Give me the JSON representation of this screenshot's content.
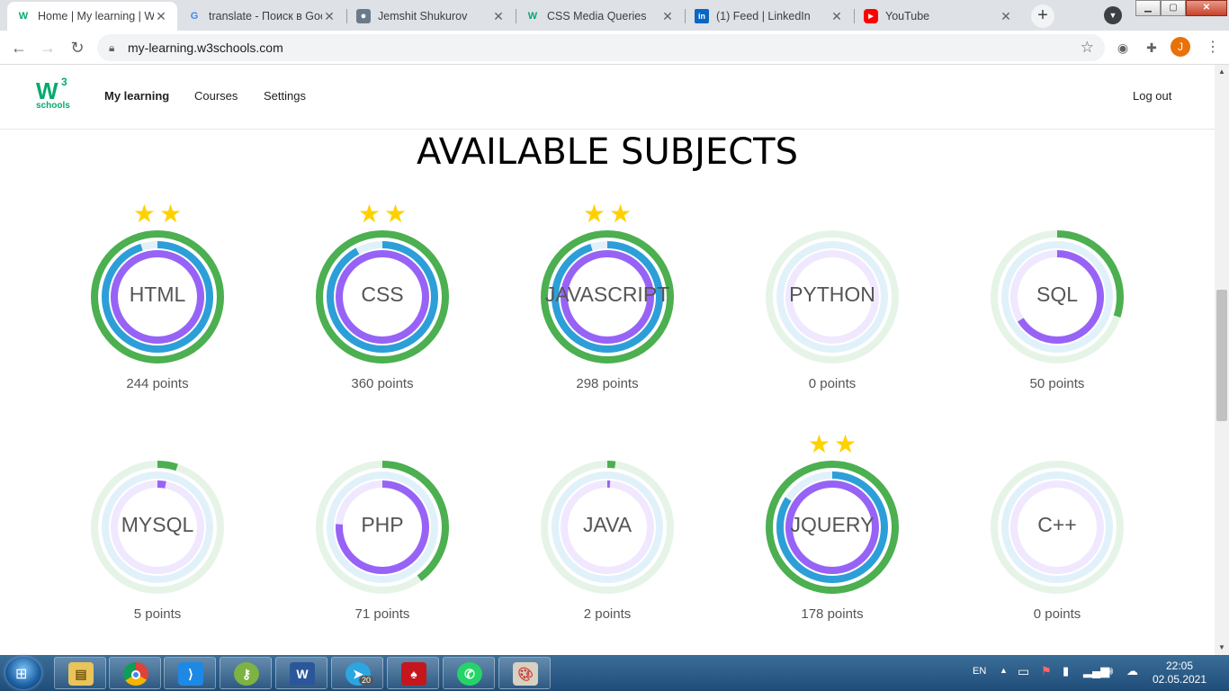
{
  "browser": {
    "tabs": [
      {
        "title": "Home | My learning | W",
        "favicon": "w3schools-icon",
        "active": true
      },
      {
        "title": "translate - Поиск в Goo",
        "favicon": "google-icon",
        "active": false
      },
      {
        "title": "Jemshit Shukurov",
        "favicon": "profile-photo-icon",
        "active": false
      },
      {
        "title": "CSS Media Queries",
        "favicon": "w3schools-icon",
        "active": false
      },
      {
        "title": "(1) Feed | LinkedIn",
        "favicon": "linkedin-icon",
        "active": false
      },
      {
        "title": "YouTube",
        "favicon": "youtube-icon",
        "active": false
      }
    ],
    "url": "my-learning.w3schools.com",
    "profile_initial": "J"
  },
  "site": {
    "logo_text": "W",
    "logo_super": "3",
    "logo_sub": "schools",
    "nav": [
      "My learning",
      "Courses",
      "Settings"
    ],
    "logout": "Log out",
    "heading": "AVAILABLE SUBJECTS"
  },
  "colors": {
    "outer_ring": "#4caf50",
    "middle_ring": "#2d9fd8",
    "inner_ring": "#9763f6",
    "outer_track": "#e6f4e7",
    "middle_track": "#e1f1fa",
    "inner_track": "#f0e8fe",
    "star": "#ffd100",
    "brand": "#04aa6d"
  },
  "subjects": [
    {
      "name": "HTML",
      "points": "244 points",
      "stars": 2,
      "progress": [
        1.0,
        0.95,
        1.0
      ]
    },
    {
      "name": "CSS",
      "points": "360 points",
      "stars": 2,
      "progress": [
        1.0,
        0.92,
        1.0
      ]
    },
    {
      "name": "JAVASCRIPT",
      "points": "298 points",
      "stars": 2,
      "progress": [
        1.0,
        0.95,
        1.0
      ]
    },
    {
      "name": "PYTHON",
      "points": "0 points",
      "stars": 0,
      "progress": [
        0,
        0,
        0
      ]
    },
    {
      "name": "SQL",
      "points": "50 points",
      "stars": 0,
      "progress": [
        0.3,
        0,
        0.66
      ]
    },
    {
      "name": "MYSQL",
      "points": "5 points",
      "stars": 0,
      "progress": [
        0.05,
        0,
        0.03
      ]
    },
    {
      "name": "PHP",
      "points": "71 points",
      "stars": 0,
      "progress": [
        0.4,
        0,
        0.76
      ]
    },
    {
      "name": "JAVA",
      "points": "2 points",
      "stars": 0,
      "progress": [
        0.02,
        0,
        0.01
      ]
    },
    {
      "name": "JQUERY",
      "points": "178 points",
      "stars": 2,
      "progress": [
        1.0,
        0.84,
        1.0
      ]
    },
    {
      "name": "C++",
      "points": "0 points",
      "stars": 0,
      "progress": [
        0,
        0,
        0
      ]
    }
  ],
  "taskbar": {
    "apps": [
      "file-explorer-icon",
      "chrome-icon",
      "vscode-icon",
      "key-app-icon",
      "word-icon",
      "telegram-icon",
      "acrobat-icon",
      "whatsapp-icon",
      "paint-icon"
    ],
    "telegram_badge": "20",
    "language": "EN",
    "time": "22:05",
    "date": "02.05.2021"
  }
}
